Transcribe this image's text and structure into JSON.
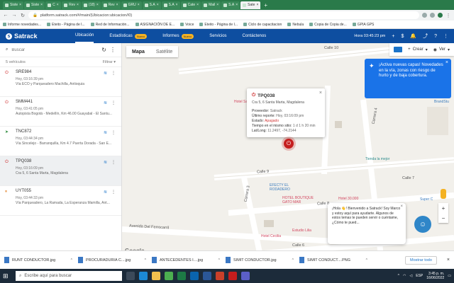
{
  "browser": {
    "tabs": [
      {
        "label": "Siste"
      },
      {
        "label": "Siste"
      },
      {
        "label": "C"
      },
      {
        "label": "Rev"
      },
      {
        "label": "(18)"
      },
      {
        "label": "Rev"
      },
      {
        "label": "GRU"
      },
      {
        "label": "S.A"
      },
      {
        "label": "S.A"
      },
      {
        "label": "Cate"
      },
      {
        "label": "Mail"
      },
      {
        "label": "S.A"
      },
      {
        "label": "Sate",
        "active": true
      }
    ],
    "new_tab": "+",
    "url": "platform.satrack.com/#/main/(Ubicacion:ubicacion//0)",
    "bookmarks": [
      "Informe novedades...",
      "Eteito - Página de I...",
      "Red de Información...",
      "ASIGNACIÓN DE E...",
      "Voice",
      "Eteito - Página de I...",
      "Ciclo de capacitacion",
      "Nebula",
      "Copia de Copia de...",
      "GPIA GPS"
    ]
  },
  "app": {
    "brand": "Satrack",
    "nav": [
      {
        "label": "Ubicación",
        "active": true
      },
      {
        "label": "Estadísticas",
        "badge": "Nuevo"
      },
      {
        "label": "Informes",
        "badge": "Nuevo"
      },
      {
        "label": "Servicios"
      },
      {
        "label": "Contáctenos"
      }
    ],
    "time": "Hora 03:45:23 pm"
  },
  "sidebar": {
    "search_placeholder": "Buscar",
    "count": "5 vehículos",
    "filter_label": "Filtrar",
    "vehicles": [
      {
        "plate": "SRE984",
        "time": "Hoy, 03:16:39 pm",
        "addr": "Vía ECO y Parqueadero Machilla, Antioquia",
        "status": "off"
      },
      {
        "plate": "SMM441",
        "time": "Hoy, 03:41:05 pm",
        "addr": "Autopista Bogotá - Medellín, Km 46.00 Guayabal - El Santu...",
        "status": "off"
      },
      {
        "plate": "TNC872",
        "time": "Hoy, 03:44:34 pm",
        "addr": "Vía Sincelejo - Barranquilla, Km 4.7 Puerta Dorada - San E...",
        "status": "moving"
      },
      {
        "plate": "TPQ038",
        "time": "Hoy, 03:16:09 pm",
        "addr": "Cra 5, 6 Santa Marta, Magdalena",
        "status": "off",
        "selected": true
      },
      {
        "plate": "UYT055",
        "time": "Hoy, 03:44:33 pm",
        "addr": "Vía Parqueadero, La Ramada, La Esperanza Mamilla, Ant...",
        "status": "idle"
      }
    ]
  },
  "map": {
    "toggle": {
      "map": "Mapa",
      "satellite": "Satélite"
    },
    "tools": {
      "create": "Crear",
      "view": "Ver"
    },
    "promo": "¡Activa nuevas capas! Novedades en la vía, zonas con riesgo de hurto y de baja cobertura.",
    "streets": [
      "Calle 10",
      "Calle 9",
      "Calle 8",
      "Carrera 4",
      "Carrera 3",
      "Avenida Del Ferrocarril",
      "Calle 7",
      "Calle 6"
    ],
    "pois": [
      {
        "label": "Hotel Sa",
        "kind": "red"
      },
      {
        "label": "EFECTY EL RODADERO",
        "kind": "blue"
      },
      {
        "label": "HOTEL BOUTIQUE GATO MAR",
        "kind": "red"
      },
      {
        "label": "Hotel 30.000",
        "kind": "red"
      },
      {
        "label": "Tienda la mejor",
        "kind": "teal"
      },
      {
        "label": "Hotel Cecilia",
        "kind": "red"
      },
      {
        "label": "Estudio Lilia",
        "kind": "red"
      },
      {
        "label": "BrandStu",
        "kind": "blue"
      },
      {
        "label": "Super C",
        "kind": "blue"
      }
    ],
    "info": {
      "plate": "TPQ038",
      "location": "Cra 5, 6 Santa Marta, Magdalena",
      "rows": [
        {
          "label": "Proveedor:",
          "value": "Satrack"
        },
        {
          "label": "Último reporte:",
          "value": "Hoy, 03:16:09 pm"
        },
        {
          "label": "Estado:",
          "value": "Apagado",
          "red": true
        },
        {
          "label": "Tiempo en el mismo sitio:",
          "value": "1 d 1 h 20 min"
        },
        {
          "label": "Lat/Long:",
          "value": "11.2497, -74.2144"
        }
      ]
    },
    "chat": "¡Hola 👋! Bienvenido a Satrack! Soy Marco y estoy aquí para ayudarte. Algunos de estos temas te pueden servir o cuéntame, ¿Cómo te pued...",
    "google": "Google",
    "attribution": [
      "Combinaciones de teclas",
      "Datos de mapas ©2022",
      "Términos de uso",
      "Notificar un problema de Maps"
    ]
  },
  "downloads": {
    "files": [
      "RUNT CONDUCTOR.jpg",
      "PROCURADURIA C....jpg",
      "ANTECEDENTES I....jpg",
      "SIMIT CONDUCTOR.jpg",
      "SIMIT CONDUCT....PNG"
    ],
    "show_all": "Mostrar todo"
  },
  "taskbar": {
    "search_placeholder": "Escribe aquí para buscar",
    "lang": "ESP",
    "time": "3:45 p. m.",
    "date": "16/06/2022"
  }
}
